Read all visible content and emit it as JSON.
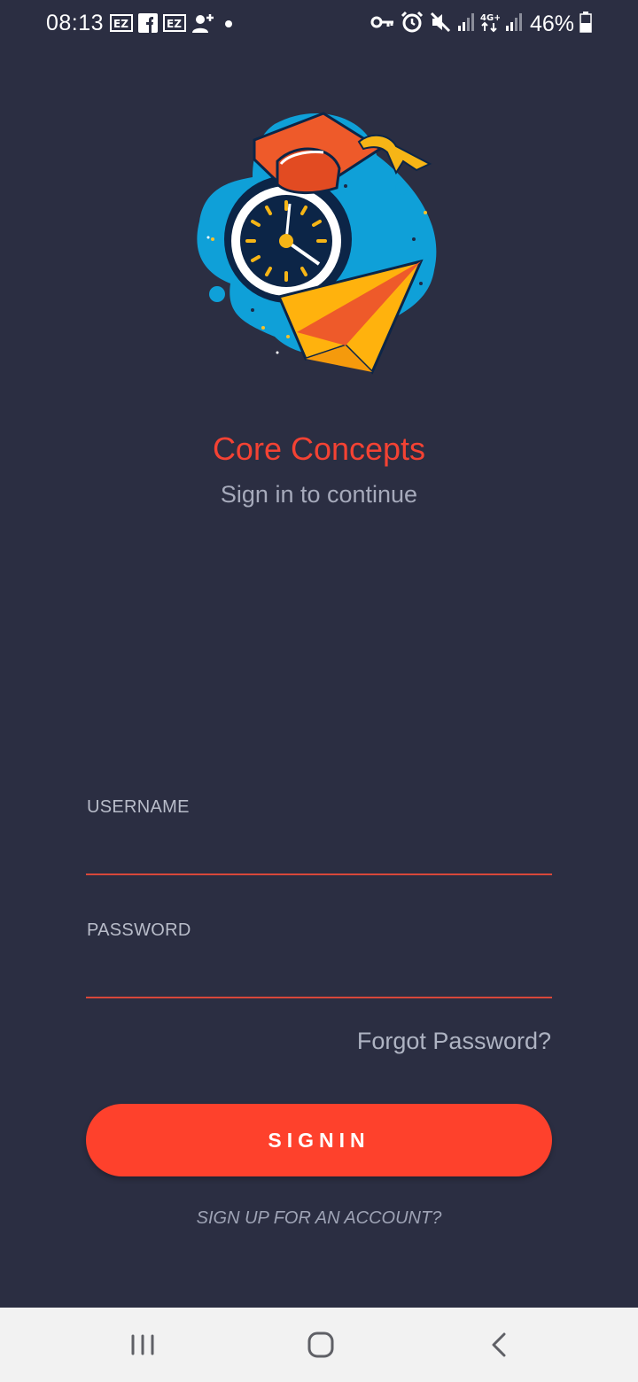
{
  "status_bar": {
    "time": "08:13",
    "battery": "46%",
    "left_icons": [
      "ez-icon",
      "facebook-icon",
      "ez-icon",
      "add-person-icon",
      "dot-icon"
    ],
    "right_icons": [
      "key-icon",
      "alarm-icon",
      "mute-icon",
      "signal-icon",
      "network-4g-icon",
      "signal-icon",
      "battery-icon"
    ]
  },
  "app": {
    "title": "Core Concepts",
    "subtitle": "Sign in to continue"
  },
  "form": {
    "username_label": "USERNAME",
    "username_value": "",
    "password_label": "PASSWORD",
    "password_value": "",
    "forgot_password": "Forgot Password?",
    "signin_label": "SIGNIN",
    "signup_label": "SIGN UP FOR AN ACCOUNT?"
  },
  "colors": {
    "background": "#2b2e42",
    "accent": "#fe412c",
    "title": "#f44233",
    "muted_text": "#a6aabb",
    "nav_bar": "#f2f2f2"
  },
  "nav_bar": {
    "items": [
      "recent-apps-icon",
      "home-icon",
      "back-icon"
    ]
  }
}
